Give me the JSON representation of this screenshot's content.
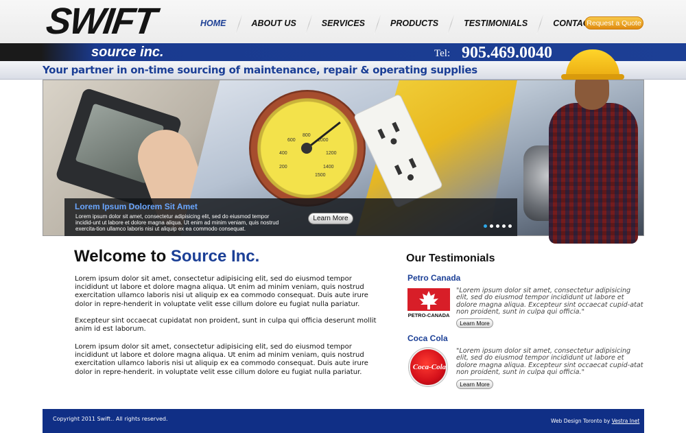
{
  "header": {
    "logo_text": "SWIFT",
    "subtitle": "source inc.",
    "tel_label": "Tel:",
    "tel_number": "905.469.0040",
    "tagline": "Your partner in on-time sourcing of maintenance, repair & operating supplies",
    "quote_button": "Request a Quote"
  },
  "nav": {
    "items": [
      {
        "label": "HOME",
        "active": true
      },
      {
        "label": "ABOUT US"
      },
      {
        "label": "SERVICES"
      },
      {
        "label": "PRODUCTS"
      },
      {
        "label": "TESTIMONIALS"
      },
      {
        "label": "CONTACT US"
      }
    ]
  },
  "hero": {
    "caption_title": "Lorem Ipsum Dolorem Sit Amet",
    "caption_text": "Lorem ipsum dolor sit amet, consectetur adipisicing elit, sed do eiusmod tempor incidid-unt ut labore et dolore magna aliqua. Ut enim ad minim veniam, quis nostrud exercita-tion ullamco laboris nisi ut aliquip ex ea commodo consequat.",
    "learn_more": "Learn More",
    "gauge_numbers": [
      "600",
      "800",
      "1000",
      "1200",
      "1400",
      "1500",
      "400",
      "200"
    ],
    "slide_count": 5,
    "active_slide": 1
  },
  "welcome": {
    "title_prefix": "Welcome to",
    "title_accent": "Source Inc.",
    "paragraphs": [
      "Lorem ipsum dolor sit amet, consectetur adipisicing elit, sed do eiusmod tempor incididunt ut labore et dolore magna aliqua. Ut enim ad minim veniam, quis nostrud exercitation ullamco laboris nisi ut aliquip ex ea commodo consequat. Duis aute irure dolor in repre-henderit in voluptate velit esse cillum dolore eu fugiat nulla pariatur.",
      "Excepteur sint occaecat cupidatat non proident, sunt in culpa qui officia deserunt mollit anim id est laborum.",
      "Lorem ipsum dolor sit amet, consectetur adipisicing elit, sed do eiusmod tempor incididunt ut labore et dolore magna aliqua. Ut enim ad minim veniam, quis nostrud exercitation ullamco laboris nisi ut aliquip ex ea commodo consequat. Duis aute irure dolor in repre-henderit. in voluptate velit esse cillum dolore eu fugiat nulla pariatur."
    ]
  },
  "testimonials": {
    "heading": "Our Testimonials",
    "items": [
      {
        "name": "Petro Canada",
        "logo_text": "PETRO-CANADA",
        "quote": "\"Lorem ipsum dolor sit amet, consectetur adipisicing elit, sed do eiusmod tempor incididunt ut labore et dolore magna aliqua. Excepteur sint occaecat cupid-atat non proident, sunt in culpa qui officia.\"",
        "button": "Learn More"
      },
      {
        "name": "Coca Cola",
        "logo_text": "Coca-Cola",
        "quote": "\"Lorem ipsum dolor sit amet, consectetur adipisicing elit, sed do eiusmod tempor incididunt ut labore et dolore magna aliqua. Excepteur sint occaecat cupid-atat non proident, sunt in culpa qui officia.\"",
        "button": "Learn More"
      }
    ]
  },
  "footer": {
    "copyright": "Copyright 2011 Swift.. All rights reserved.",
    "credit_prefix": "Web Design Toronto by",
    "credit_link": "Vestra Inet"
  },
  "colors": {
    "brand_blue": "#1c3f95",
    "quote_orange": "#e08b10",
    "slide_dot_active": "#2ea8e8"
  }
}
